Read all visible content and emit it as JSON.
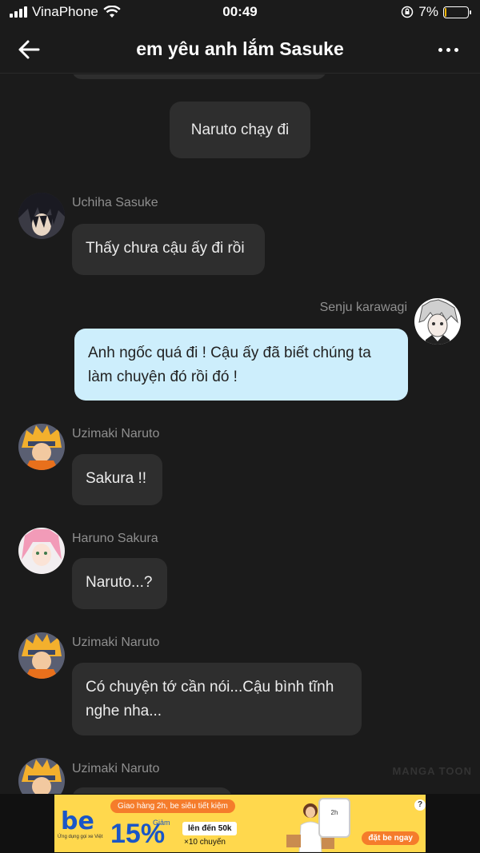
{
  "status_bar": {
    "carrier": "VinaPhone",
    "time": "00:49",
    "battery_percent": "7%",
    "battery_level": 0.07
  },
  "header": {
    "title": "em yêu anh lắm Sasuke"
  },
  "messages": [
    {
      "type": "center",
      "text": "Naruto chạy đi"
    },
    {
      "type": "incoming",
      "sender": "Uchiha Sasuke",
      "avatar": "sasuke-avatar",
      "text": "Thấy chưa cậu ấy đi rồi"
    },
    {
      "type": "outgoing",
      "sender": "Senju karawagi",
      "avatar": "karawagi-avatar",
      "lines": [
        "Anh ngốc quá đi ! Cậu ấy đã biết chúng ta",
        "làm chuyện đó rồi đó !"
      ]
    },
    {
      "type": "incoming",
      "sender": "Uzimaki Naruto",
      "avatar": "naruto-avatar",
      "text": "Sakura !!"
    },
    {
      "type": "incoming",
      "sender": "Haruno Sakura",
      "avatar": "sakura-avatar",
      "text": "Naruto...?"
    },
    {
      "type": "incoming",
      "sender": "Uzimaki Naruto",
      "avatar": "naruto-avatar",
      "lines": [
        "Có chuyện tớ cần nói...Cậu bình tĩnh",
        "nghe nha..."
      ]
    },
    {
      "type": "incoming",
      "sender": "Uzimaki Naruto",
      "avatar": "naruto-avatar",
      "text": ""
    }
  ],
  "watermark": "MANGA TOON",
  "ad": {
    "brand": "be",
    "brand_sub": "Ứng dụng gọi xe Việt",
    "headline": "Giao hàng 2h, be siêu tiết kiệm",
    "discount": "15%",
    "discount_label": "Giảm",
    "cap": "lên đến 50k",
    "times": "×10 chuyến",
    "phone_text": "2h",
    "cta": "đặt be ngay",
    "help": "?",
    "colors": {
      "background": "#ffd84d",
      "brand_blue": "#1a56c7",
      "accent_orange": "#f57c2b"
    }
  },
  "icons": [
    "signal-icon",
    "wifi-icon",
    "lock-rotation-icon",
    "battery-icon",
    "back-arrow-icon",
    "more-dots-icon"
  ],
  "colors": {
    "background": "#1b1b1b",
    "bubble": "#2e2e2e",
    "my_bubble": "#cdeefc",
    "sender_text": "#8f8f8f"
  }
}
